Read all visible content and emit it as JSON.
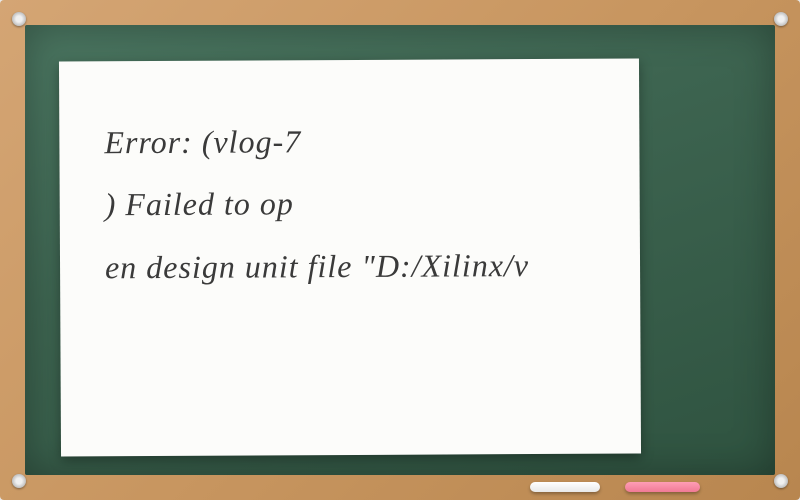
{
  "error": {
    "line1": "Error: (vlog-7",
    "line2": ") Failed to op",
    "line3": "en design unit file \"D:/Xilinx/v"
  }
}
